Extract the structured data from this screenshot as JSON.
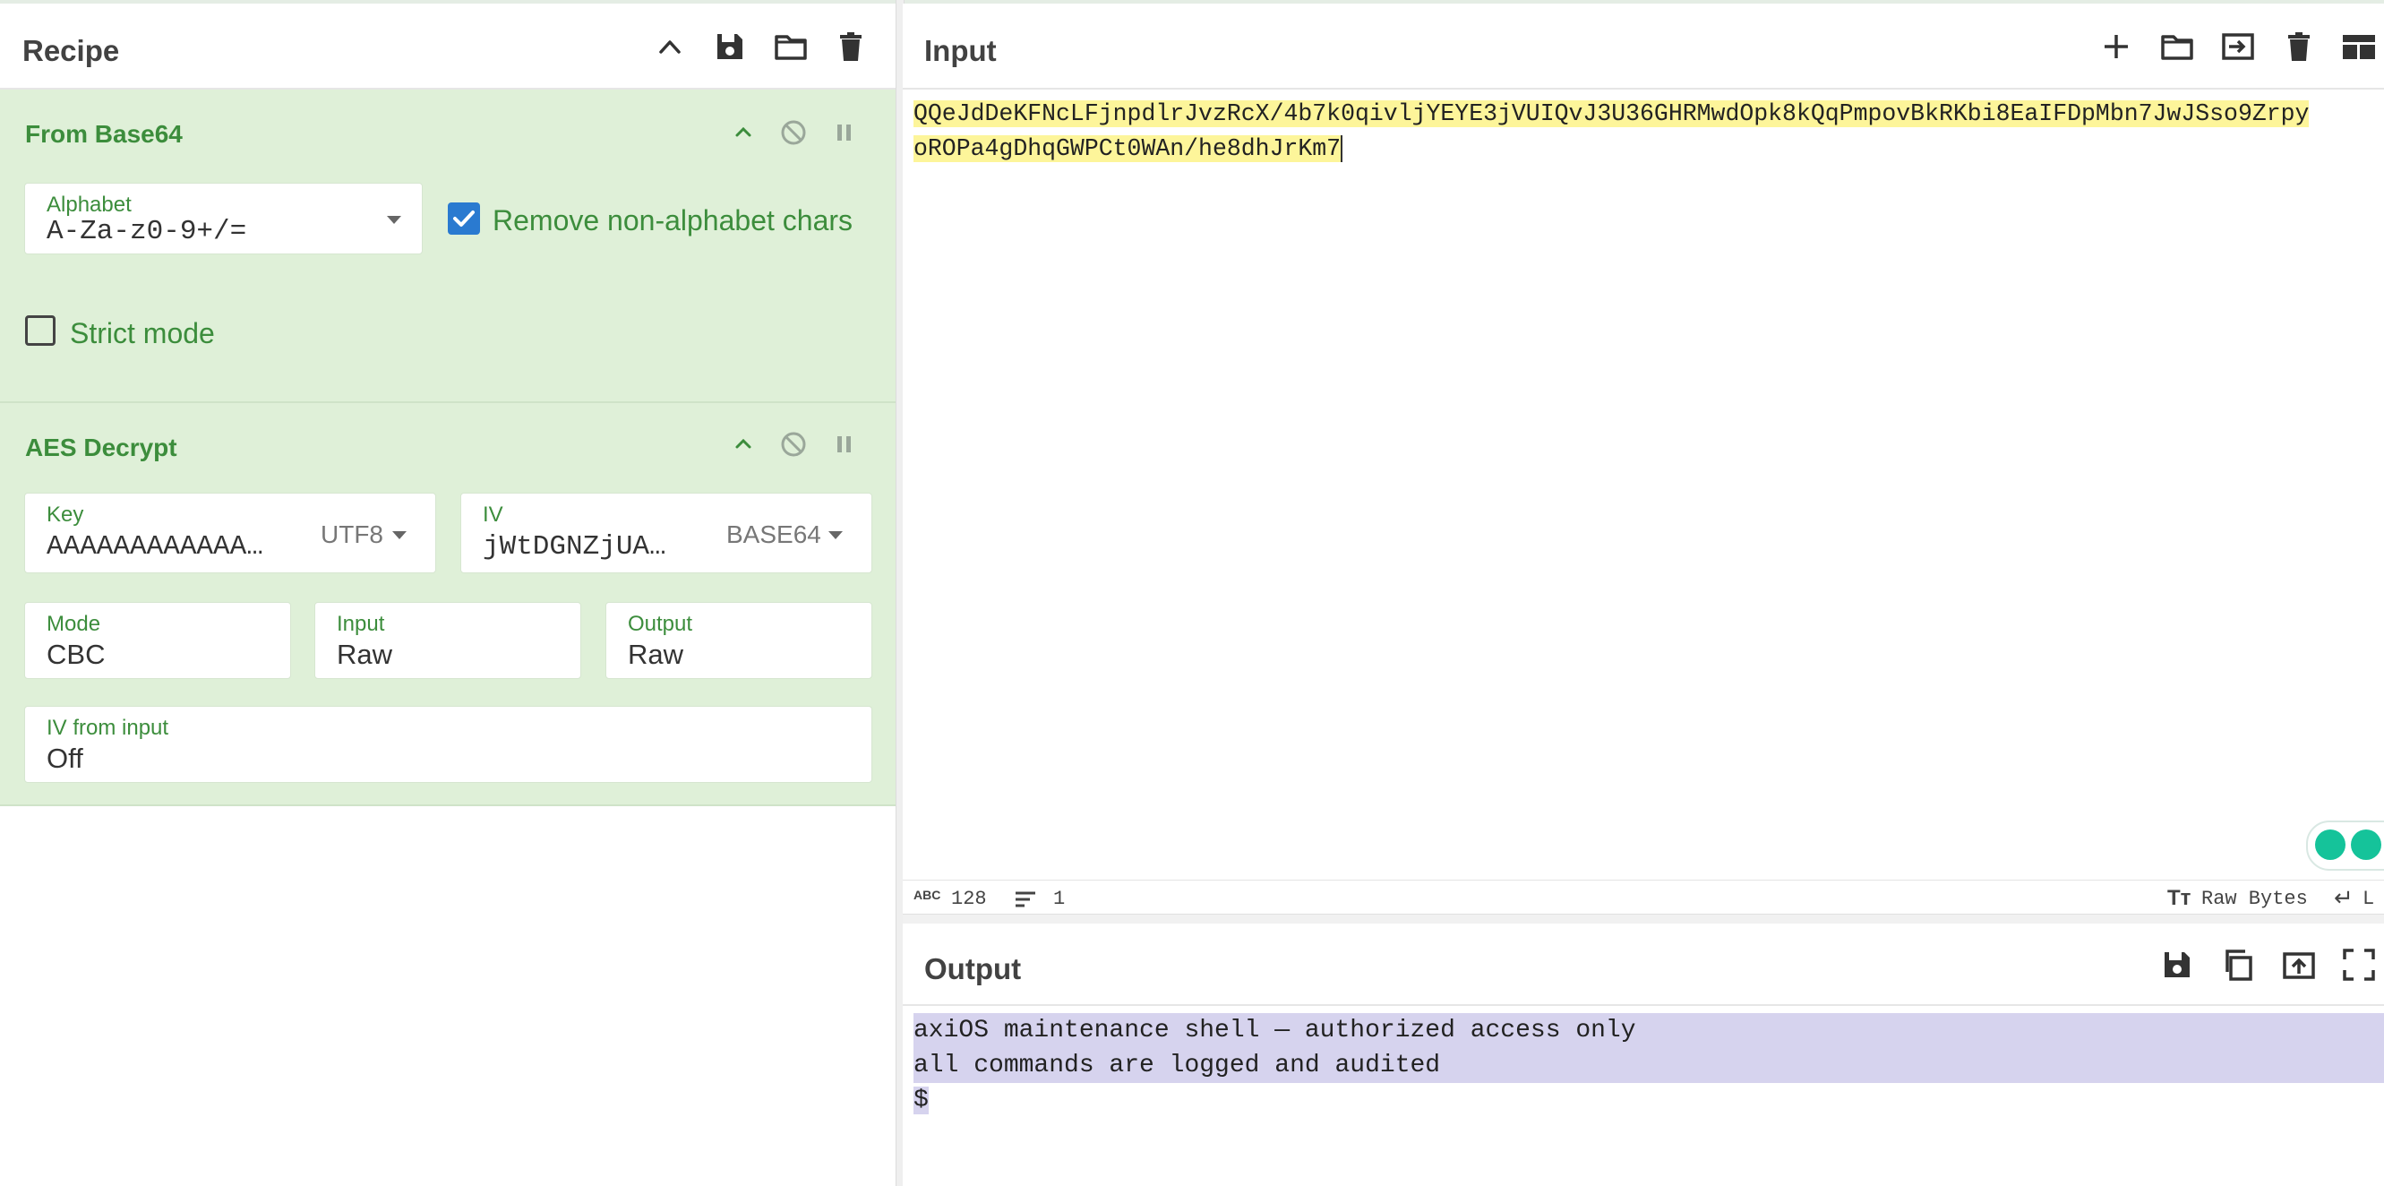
{
  "recipe": {
    "title": "Recipe",
    "icons": [
      "chevron-up-icon",
      "save-icon",
      "folder-icon",
      "trash-icon"
    ]
  },
  "operations": [
    {
      "name": "From Base64",
      "alphabet_label": "Alphabet",
      "alphabet_value": "A-Za-z0-9+/=",
      "remove_non_alphabet_label": "Remove non-alphabet chars",
      "remove_non_alphabet_checked": true,
      "strict_mode_label": "Strict mode",
      "strict_mode_checked": false
    },
    {
      "name": "AES Decrypt",
      "key_label": "Key",
      "key_value": "AAAAAAAAAAAA…",
      "key_encoding": "UTF8",
      "iv_label": "IV",
      "iv_value": "jWtDGNZjUA…",
      "iv_encoding": "BASE64",
      "mode_label": "Mode",
      "mode_value": "CBC",
      "input_label": "Input",
      "input_value": "Raw",
      "output_label": "Output",
      "output_value": "Raw",
      "iv_from_input_label": "IV from input",
      "iv_from_input_value": "Off"
    }
  ],
  "input": {
    "title": "Input",
    "line1": "QQeJdDeKFNcLFjnpdlrJvzRcX/4b7k0qivljYEYE3jVUIQvJ3U36GHRMwdOpk8kQqPmpovBkRKbi8EaIFDpMbn7JwJSso9Zrpy",
    "line2": "oROPa4gDhqGWPCt0WAn/he8dhJrKm7",
    "char_count": "128",
    "line_count": "1",
    "format_label": "Raw Bytes",
    "eol_label": "L"
  },
  "output": {
    "title": "Output",
    "line1": "axiOS maintenance shell — authorized access only",
    "line2": "all commands are logged and audited",
    "line3": "$"
  },
  "colors": {
    "op_bg": "#dff0d8",
    "op_text": "#3c8d3c",
    "input_highlight": "#fdf59a",
    "output_highlight": "#d6d3ee",
    "checkbox": "#2a7ad0"
  }
}
